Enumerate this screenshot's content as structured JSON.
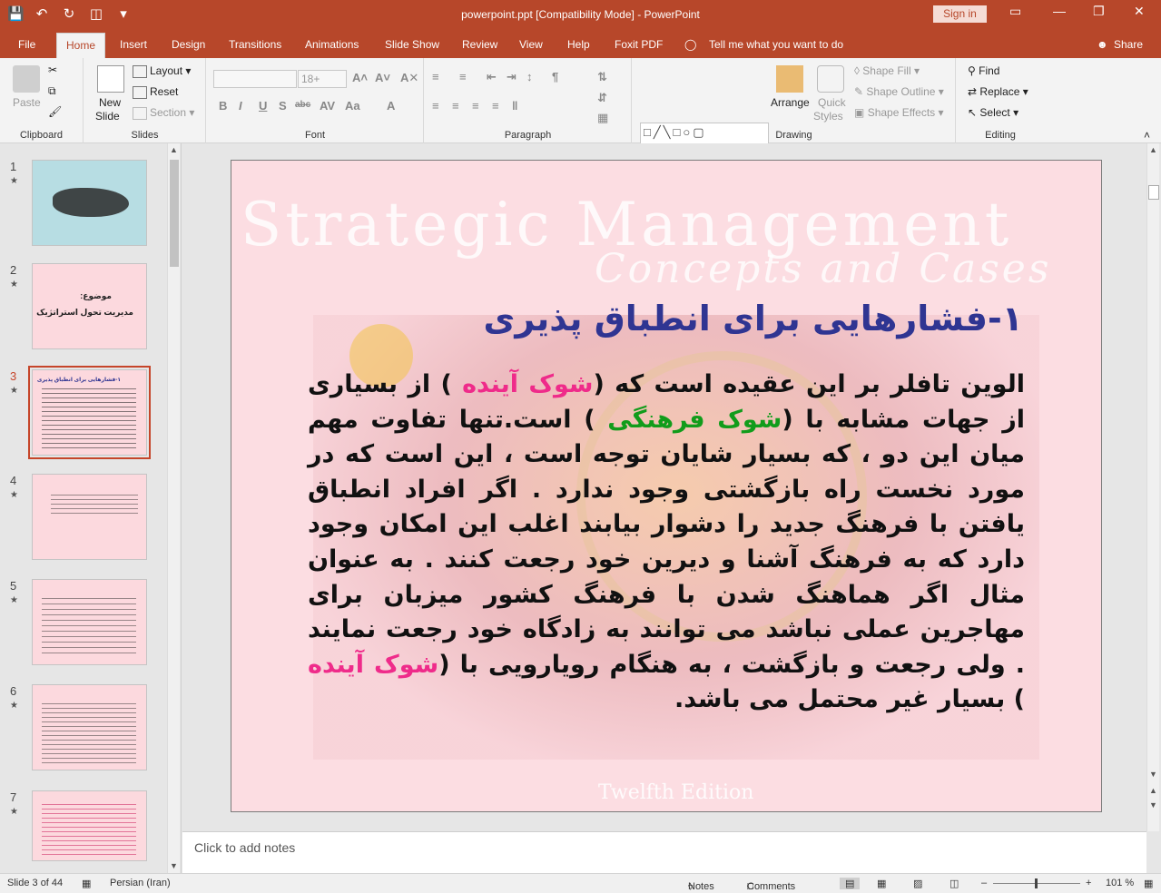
{
  "titlebar": {
    "title": "powerpoint.ppt [Compatibility Mode]  -  PowerPoint",
    "signin": "Sign in"
  },
  "tabs": [
    "File",
    "Home",
    "Insert",
    "Design",
    "Transitions",
    "Animations",
    "Slide Show",
    "Review",
    "View",
    "Help",
    "Foxit PDF"
  ],
  "tell_me": "Tell me what you want to do",
  "share": "Share",
  "ribbon": {
    "clipboard": {
      "label": "Clipboard",
      "paste": "Paste"
    },
    "slides": {
      "label": "Slides",
      "new_slide": "New",
      "new_slide2": "Slide",
      "layout": "Layout",
      "reset": "Reset",
      "section": "Section"
    },
    "font": {
      "label": "Font",
      "size": "18+"
    },
    "paragraph": {
      "label": "Paragraph"
    },
    "drawing": {
      "label": "Drawing",
      "arrange": "Arrange",
      "quick_styles": "Quick",
      "quick_styles2": "Styles",
      "shape_fill": "Shape Fill",
      "shape_outline": "Shape Outline",
      "shape_effects": "Shape Effects"
    },
    "editing": {
      "label": "Editing",
      "find": "Find",
      "replace": "Replace",
      "select": "Select"
    }
  },
  "thumbnails": [
    {
      "num": "1",
      "title": "",
      "lines": []
    },
    {
      "num": "2",
      "title": "موضوع:",
      "lines": [
        "مدیریت تحول استراتژیک"
      ]
    },
    {
      "num": "3",
      "title": "۱-فشارهایی برای انطباق پذیری",
      "lines": []
    },
    {
      "num": "4",
      "title": "",
      "lines": []
    },
    {
      "num": "5",
      "title": "",
      "lines": []
    },
    {
      "num": "6",
      "title": "",
      "lines": []
    },
    {
      "num": "7",
      "title": "",
      "lines": []
    }
  ],
  "slide": {
    "bg_title": "Strategic Management",
    "bg_subtitle": "Concepts and Cases",
    "bg_edition": "Twelfth Edition",
    "heading": "۱-فشارهایی برای انطباق پذیری",
    "body": {
      "p1": "الوین تافلر بر این عقیده است که (",
      "h1": "شوک آینده",
      "p2": " ) از بسیاری از جهات مشابه با (",
      "h2": "شوک فرهنگی",
      "p3": " ) است.تنها تفاوت مهم میان این دو ، که بسیار شایان توجه است ، این است که در مورد نخست راه بازگشتی وجود ندارد . اگر افراد انطباق یافتن با فرهنگ جدید را دشوار بیابند اغلب این امکان وجود دارد که به فرهنگ آشنا و دیرین خود رجعت کنند . به عنوان مثال اگر هماهنگ شدن با فرهنگ کشور میزبان برای مهاجرین عملی نباشد می توانند به زادگاه خود رجعت نمایند . ولی رجعت و بازگشت ، به هنگام رویارویی با (",
      "h3": "شوک آینده",
      "p4": " ) بسیار غیر محتمل می باشد."
    }
  },
  "notes_placeholder": "Click to add notes",
  "status": {
    "slide_info": "Slide 3 of 44",
    "language": "Persian (Iran)",
    "notes": "Notes",
    "comments": "Comments",
    "zoom": "101 %"
  },
  "colors": {
    "accent": "#b7472a",
    "heading": "#2f3592",
    "pink": "#ef2b8a",
    "green": "#119c1b",
    "slide_bg": "#fcdde2"
  }
}
